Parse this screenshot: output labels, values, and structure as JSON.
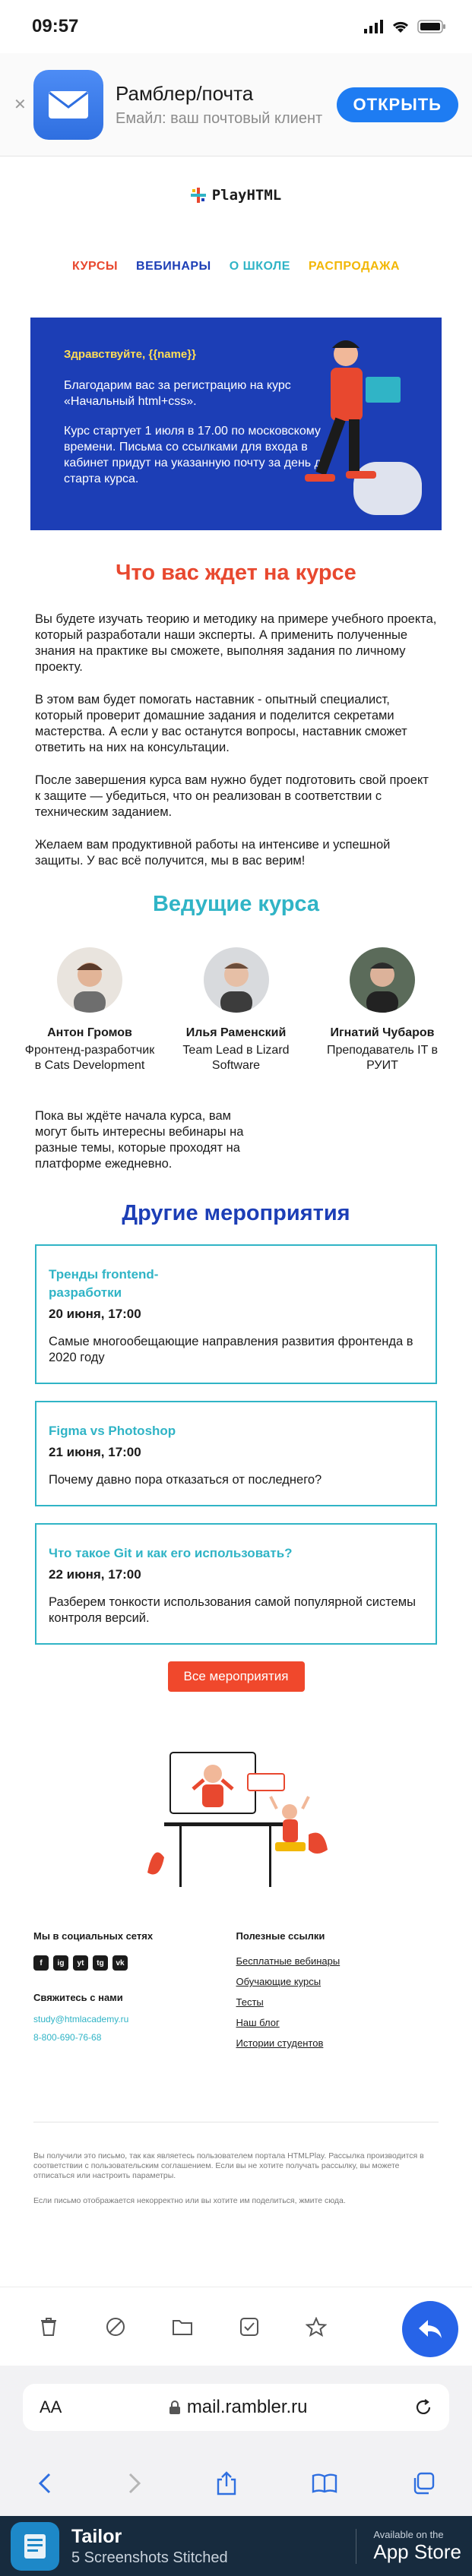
{
  "status_bar": {
    "time": "09:57"
  },
  "app_banner": {
    "title": "Рамблер/почта",
    "subtitle": "Емайл: ваш почтовый клиент",
    "open_label": "ОТКРЫТЬ"
  },
  "logo": {
    "text": "PlayHTML"
  },
  "nav": [
    {
      "label": "КУРСЫ",
      "color": "#e8482f"
    },
    {
      "label": "ВЕБИНАРЫ",
      "color": "#1c3eb6"
    },
    {
      "label": "О ШКОЛЕ",
      "color": "#30b4c6"
    },
    {
      "label": "РАСПРОДАЖА",
      "color": "#f2b705"
    }
  ],
  "hero": {
    "greeting": "Здравствуйте, {{name}}",
    "para1": "Благодарим вас за регистрацию на курс «Начальный html+css».",
    "para2": "Курс стартует 1 июля в 17.00 по московскому времени. Письма со ссылками для входа в кабинет придут на указанную почту за день до старта курса."
  },
  "expect": {
    "title": "Что вас ждет на курсе",
    "p1": "Вы будете изучать теорию и методику на примере учебного проекта, который разработали наши эксперты. А применить полученные знания на практике вы сможете, выполняя задания по личному проекту.",
    "p2": "В этом вам будет помогать наставник - опытный специалист, который проверит домашние задания и поделится секретами мастерства. А если у вас останутся вопросы, наставник сможет ответить на них на консультации.",
    "p3": "После завершения курса вам нужно будет подготовить свой проект к защите — убедиться, что он реализован в соответствии с техническим заданием.",
    "p4": "Желаем вам продуктивной работы на интенсиве и успешной защиты. У вас всё получится, мы в вас верим!"
  },
  "speakers": {
    "title": "Ведущие курса",
    "items": [
      {
        "name": "Антон Громов",
        "role": "Фронтенд-разработчик в Cats Development"
      },
      {
        "name": "Илья Раменский",
        "role": "Team Lead в Lizard Software"
      },
      {
        "name": "Игнатий Чубаров",
        "role": "Преподаватель IT в РУИТ"
      }
    ]
  },
  "waiting_text": "Пока вы ждёте начала курса, вам могут быть интересны вебинары на разные темы, которые проходят на платформе ежедневно.",
  "events": {
    "title": "Другие мероприятия",
    "items": [
      {
        "tag": "Тренды frontend-разработки",
        "date": "20 июня, 17:00",
        "desc": "Самые многообещающие направления развития фронтенда в 2020 году"
      },
      {
        "tag": "Figma vs Photoshop",
        "date": "21 июня, 17:00",
        "desc": "Почему давно пора отказаться от последнего?"
      },
      {
        "tag": "Что такое Git и как его использовать?",
        "date": "22 июня, 17:00",
        "desc": "Разберем тонкости использования самой популярной системы контроля версий."
      }
    ],
    "all_label": "Все мероприятия"
  },
  "footer": {
    "social_heading": "Мы в социальных сетях",
    "social_icons": [
      "f",
      "ig",
      "yt",
      "tg",
      "vk"
    ],
    "contact_heading": "Свяжитесь с нами",
    "email": "study@htmlacademy.ru",
    "phone": "8-800-690-76-68",
    "links_heading": "Полезные ссылки",
    "links": [
      "Бесплатные вебинары",
      "Обучающие курсы",
      "Тесты",
      "Наш блог",
      "Истории студентов"
    ]
  },
  "legal": {
    "p1": "Вы получили это письмо, так как являетесь пользователем портала HTMLPlay. Рассылка производится в соответствии с пользовательским соглашением. Если вы не хотите получать рассылку, вы можете отписаться или настроить параметры.",
    "p2": "Если письмо отображается некорректно или вы хотите им поделиться, жмите сюда."
  },
  "browser": {
    "aa": "AA",
    "url": "mail.rambler.ru"
  },
  "tailor": {
    "title": "Tailor",
    "subtitle": "5 Screenshots Stitched",
    "available": "Available on the",
    "store": "App Store"
  },
  "colors": {
    "accent_blue": "#1c3eb6",
    "accent_red": "#e8482f",
    "accent_teal": "#30b4c6",
    "accent_yellow": "#f2b705"
  }
}
